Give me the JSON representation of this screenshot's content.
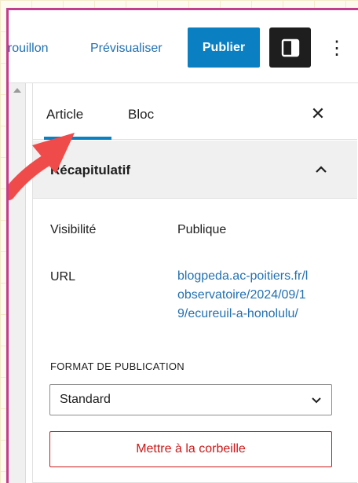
{
  "toolbar": {
    "draft_label": "brouillon",
    "preview_label": "Prévisualiser",
    "publish_label": "Publier",
    "sidebar_toggle_icon": "sidebar-panel-icon",
    "more_icon": "more-vertical-icon",
    "more_glyph": "⋮",
    "accent_color": "#0a7fc2"
  },
  "panel": {
    "tabs": [
      {
        "label": "Article",
        "active": true
      },
      {
        "label": "Bloc",
        "active": false
      }
    ],
    "close_glyph": "✕",
    "summary": {
      "title": "Récapitulatif",
      "expanded": true
    },
    "visibility": {
      "label": "Visibilité",
      "value": "Publique"
    },
    "url": {
      "label": "URL",
      "value": "blogpeda.ac-poitiers.fr/lobservatoire/2024/09/19/ecureuil-a-honolulu/"
    },
    "format": {
      "label": "FORMAT DE PUBLICATION",
      "value": "Standard"
    },
    "trash_label": "Mettre à la corbeille",
    "danger_color": "#cc1818"
  },
  "annotation": {
    "arrow_color": "#f04b4b"
  }
}
